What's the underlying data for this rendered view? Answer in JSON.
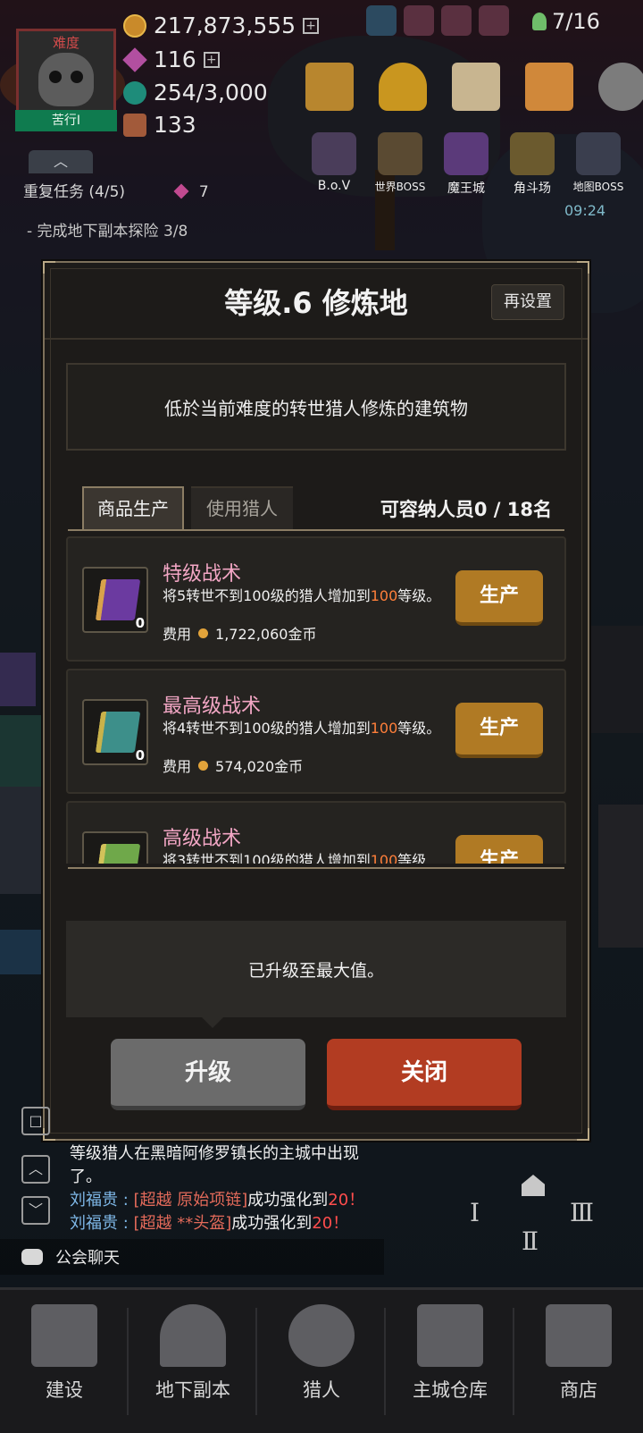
{
  "hud": {
    "difficulty_label": "难度",
    "difficulty_level": "苦行Ⅰ",
    "gold": "217,873,555",
    "gems": "116",
    "stamina": "254/3,000",
    "chests": "133",
    "population": "7/16",
    "menu_icons": [
      "codex-icon",
      "trophy-icon",
      "mail-icon",
      "event-icon",
      "settings-icon"
    ],
    "bosses": [
      {
        "label": "B.o.V",
        "icon": "bov-icon"
      },
      {
        "label": "世界BOSS",
        "icon": "world-boss-icon"
      },
      {
        "label": "魔王城",
        "icon": "demon-castle-icon"
      },
      {
        "label": "角斗场",
        "icon": "arena-icon"
      },
      {
        "label": "地图BOSS",
        "icon": "map-boss-icon"
      }
    ],
    "timer": "09:24",
    "quest_title": "重复任务 (4/5)",
    "quest_reward": "7",
    "quest_detail": "- 完成地下副本探险 3/8"
  },
  "dialog": {
    "title": "等级.6 修炼地",
    "reset_label": "再设置",
    "description": "低於当前难度的转世猎人修炼的建筑物",
    "tabs": [
      "商品生产",
      "使用猎人"
    ],
    "capacity": "可容纳人员0 / 18名",
    "items": [
      {
        "name": "特级战术",
        "desc_prefix": "将5转世不到100级的猎人增加到",
        "desc_highlight": "100",
        "desc_suffix": "等级。",
        "cost_label": "费用",
        "cost": "1,722,060金币",
        "quantity": "0",
        "button": "生产",
        "book_color": "purple"
      },
      {
        "name": "最高级战术",
        "desc_prefix": "将4转世不到100级的猎人增加到",
        "desc_highlight": "100",
        "desc_suffix": "等级。",
        "cost_label": "费用",
        "cost": "574,020金币",
        "quantity": "0",
        "button": "生产",
        "book_color": "teal"
      },
      {
        "name": "高级战术",
        "desc_prefix": "将3转世不到100级的猎人增加到",
        "desc_highlight": "100",
        "desc_suffix": "等级",
        "cost_label": "",
        "cost": "",
        "quantity": "",
        "button": "生产",
        "book_color": "green"
      }
    ],
    "status": "已升级至最大值。",
    "upgrade_label": "升级",
    "close_label": "关闭"
  },
  "chat": {
    "line1": "等级猎人在黑暗阿修罗镇长的主城中出现",
    "line1b": "了。",
    "msg2_user": "刘福贵 : ",
    "msg2_item": "[超越 原始项链]",
    "msg2_text": "成功强化到",
    "msg2_num": "20！",
    "msg3_user": "刘福贵 : ",
    "msg3_item": "[超越 **头盔]",
    "msg3_text": "成功强化到",
    "msg3_num": "20！",
    "guild_chat_label": "公会聊天"
  },
  "nav": [
    {
      "label": "建设",
      "icon": "hammer-icon"
    },
    {
      "label": "地下副本",
      "icon": "dungeon-gate-icon"
    },
    {
      "label": "猎人",
      "icon": "hunter-icon"
    },
    {
      "label": "主城仓库",
      "icon": "warehouse-chest-icon"
    },
    {
      "label": "商店",
      "icon": "shop-icon"
    }
  ]
}
